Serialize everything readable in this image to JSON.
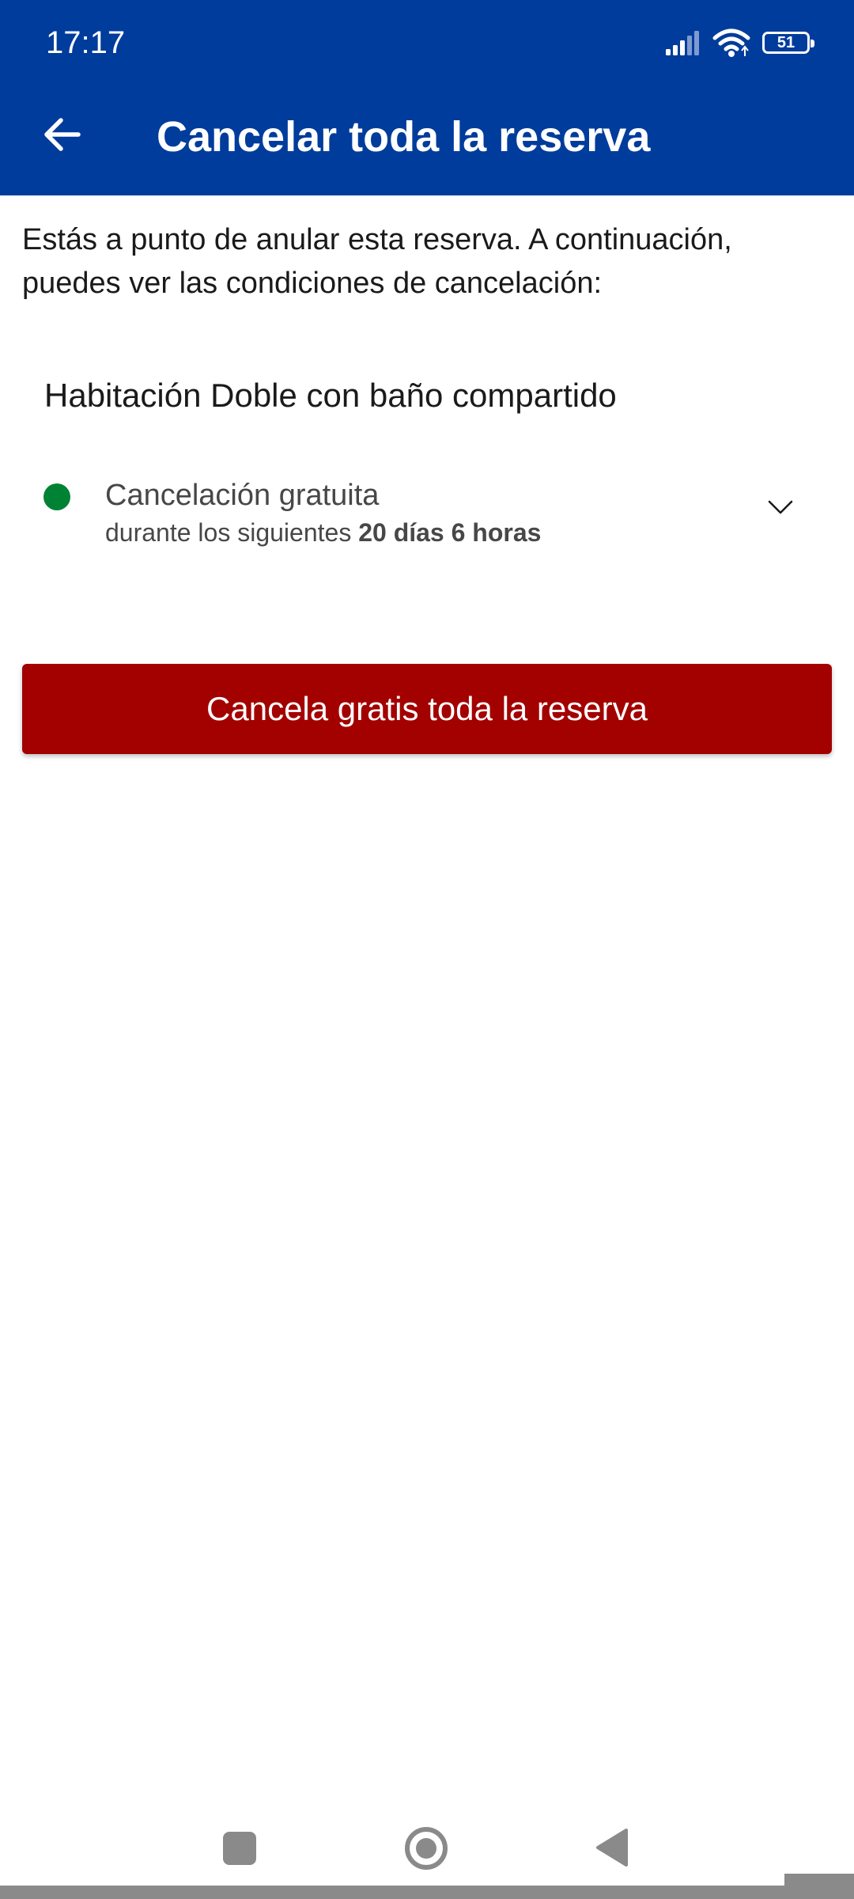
{
  "status_bar": {
    "time": "17:17",
    "battery_level": "51",
    "icons": [
      "signal-icon",
      "wifi-icon",
      "battery-icon"
    ]
  },
  "toolbar": {
    "back_icon": "arrow-left-icon",
    "title": "Cancelar toda la reserva"
  },
  "content": {
    "intro": "Estás a punto de anular esta reserva. A continuación, puedes ver las condiciones de cancelación:",
    "room_name": "Habitación Doble con baño compartido",
    "policy": {
      "label": "Cancelación gratuita",
      "detail_prefix": "durante los siguientes ",
      "detail_emphasis": "20 días 6 horas",
      "status_color": "#008234",
      "expand_icon": "chevron-down-icon"
    },
    "cta_label": "Cancela gratis toda la reserva"
  },
  "colors": {
    "header_bg": "#003c9c",
    "cta_bg": "#a30000",
    "text_primary": "#1a1a1a",
    "text_secondary": "#474747"
  },
  "nav_bar": {
    "icons": [
      "recents-icon",
      "home-icon",
      "back-triangle-icon"
    ]
  }
}
